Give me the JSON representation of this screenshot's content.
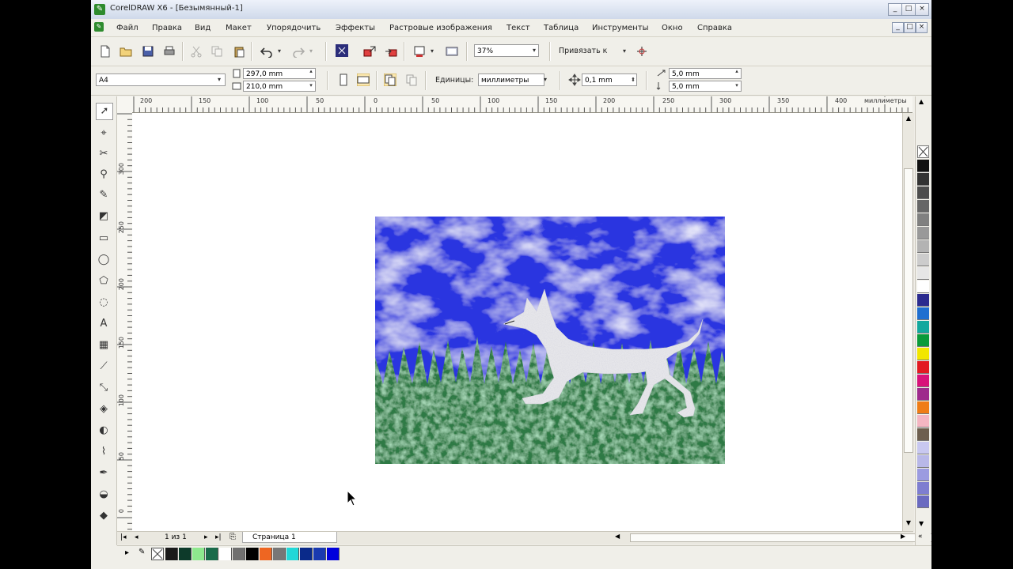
{
  "window": {
    "title": "CorelDRAW X6 - [Безымянный-1]",
    "controls": [
      "_",
      "□",
      "×"
    ],
    "doc_controls": [
      "_",
      "□",
      "×"
    ]
  },
  "menu": {
    "items": [
      "Файл",
      "Правка",
      "Вид",
      "Макет",
      "Упорядочить",
      "Эффекты",
      "Растровые изображения",
      "Текст",
      "Таблица",
      "Инструменты",
      "Окно",
      "Справка"
    ]
  },
  "toolbar1": {
    "zoom_value": "37%",
    "snap_label": "Привязать к"
  },
  "toolbar2": {
    "page_size": "A4",
    "width_value": "297,0 mm",
    "height_value": "210,0 mm",
    "units_label": "Единицы:",
    "units_value": "миллиметры",
    "nudge_value": "0,1 mm",
    "dup_x": "5,0 mm",
    "dup_y": "5,0 mm"
  },
  "ruler": {
    "h_labels": [
      "200",
      "150",
      "100",
      "50",
      "0",
      "50",
      "100",
      "150",
      "200",
      "250",
      "300",
      "350",
      "400"
    ],
    "h_unit": "миллиметры",
    "v_labels": [
      "300",
      "250",
      "200",
      "150",
      "100",
      "50",
      "0"
    ]
  },
  "document": {
    "page_counter": "1 из 1",
    "page_tab": "Страница 1"
  },
  "colors": {
    "palette": [
      "#111111",
      "#333333",
      "#4d4d4d",
      "#666666",
      "#808080",
      "#999999",
      "#b3b3b3",
      "#cccccc",
      "#e6e6e6",
      "#ffffff",
      "#2b2b8f",
      "#1f6fd0",
      "#13a89e",
      "#0a9a3a",
      "#f2e600",
      "#e21a22",
      "#d8127a",
      "#9e2a8c",
      "#ef7d16",
      "#f4b6c2",
      "#6d5e4e",
      "#c8c8f0",
      "#b8b8e8",
      "#9b9be0",
      "#7e7ed0",
      "#6a6ac0"
    ],
    "doc_palette": [
      "#1a1a1a",
      "#0d3a2a",
      "#8ee88e",
      "#1a6b4a",
      "#ffffff",
      "#707070",
      "#000000",
      "#ee6622",
      "#777777",
      "#22d8d8",
      "#0a2a8a",
      "#1a3ab0",
      "#0000dd"
    ],
    "sky": "#2a36e0",
    "grass": "#2f7a45",
    "dog": "#e6e6ea"
  }
}
